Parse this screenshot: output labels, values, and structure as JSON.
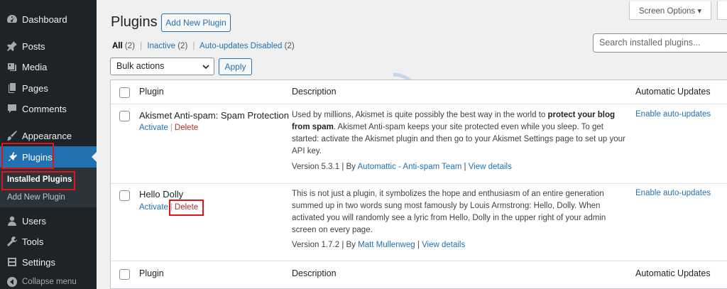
{
  "sidebar": {
    "items": [
      {
        "label": "Dashboard",
        "icon": "dashboard-icon"
      },
      {
        "label": "Posts",
        "icon": "pushpin-icon"
      },
      {
        "label": "Media",
        "icon": "media-icon"
      },
      {
        "label": "Pages",
        "icon": "pages-icon"
      },
      {
        "label": "Comments",
        "icon": "comments-icon"
      },
      {
        "label": "Appearance",
        "icon": "paintbrush-icon"
      },
      {
        "label": "Plugins",
        "icon": "plugins-icon"
      },
      {
        "label": "Users",
        "icon": "users-icon"
      },
      {
        "label": "Tools",
        "icon": "wrench-icon"
      },
      {
        "label": "Settings",
        "icon": "settings-icon"
      },
      {
        "label": "Collapse menu",
        "icon": "collapse-icon"
      }
    ],
    "submenu": {
      "installed": "Installed Plugins",
      "add_new": "Add New Plugin"
    }
  },
  "header": {
    "title": "Plugins",
    "add_new": "Add New Plugin",
    "screen_options": "Screen Options ▾"
  },
  "filters": {
    "all": "All",
    "all_count": "(2)",
    "inactive": "Inactive",
    "inactive_count": "(2)",
    "auto": "Auto-updates Disabled",
    "auto_count": "(2)",
    "sep": "|"
  },
  "search": {
    "placeholder": "Search installed plugins..."
  },
  "bulk": {
    "selected": "Bulk actions",
    "apply": "Apply"
  },
  "table": {
    "headers": {
      "plugin": "Plugin",
      "description": "Description",
      "auto": "Automatic Updates"
    },
    "rows": [
      {
        "name": "Akismet Anti-spam: Spam Protection",
        "activate": "Activate",
        "sep": "|",
        "delete": "Delete",
        "desc_1": "Used by millions, Akismet is quite possibly the best way in the world to ",
        "desc_bold": "protect your blog from spam",
        "desc_2": ". Akismet Anti-spam keeps your site protected even while you sleep. To get started: activate the Akismet plugin and then go to your Akismet Settings page to set up your API key.",
        "version": "Version 5.3.1 | By ",
        "author": "Automattic - Anti-spam Team",
        "vsep": " | ",
        "details": "View details",
        "auto": "Enable auto-updates"
      },
      {
        "name": "Hello Dolly",
        "activate": "Activate",
        "sep": "|",
        "delete": "Delete",
        "desc": "This is not just a plugin, it symbolizes the hope and enthusiasm of an entire generation summed up in two words sung most famously by Louis Armstrong: Hello, Dolly. When activated you will randomly see a lyric from Hello, Dolly in the upper right of your admin screen on every page.",
        "version": "Version 1.7.2 | By ",
        "author": "Matt Mullenweg",
        "vsep": " | ",
        "details": "View details",
        "auto": "Enable auto-updates"
      }
    ]
  },
  "watermark": {
    "line1": "accu",
    "line2": "web hosting"
  },
  "colors": {
    "sidebar_bg": "#1d2327",
    "accent": "#2271b1",
    "delete": "#b32d2e",
    "highlight": "#e1141e"
  }
}
